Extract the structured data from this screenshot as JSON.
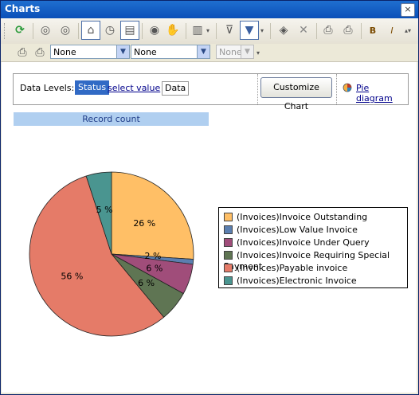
{
  "window": {
    "title": "Charts",
    "close_glyph": "×"
  },
  "toolbar2": {
    "select1": "None",
    "select2": "None",
    "select3": "None"
  },
  "level_bar": {
    "label": "Data Levels:",
    "status": "Status",
    "select_value": "select value",
    "data": "Data",
    "customize": "Customize Chart",
    "pie_link": "Pie diagram"
  },
  "record_header": "Record count",
  "chart_data": {
    "type": "pie",
    "series": [
      {
        "name": "(Invoices)Invoice Outstanding",
        "value": 26,
        "label": "26 %",
        "color": "#ffbf66"
      },
      {
        "name": "(Invoices)Low Value Invoice",
        "value": 1,
        "label": "",
        "color": "#5b7fb0"
      },
      {
        "name": "(Invoices)Invoice Under Query",
        "value": 6,
        "label": "6 %",
        "color": "#a04d7a"
      },
      {
        "name": "(Invoices)Invoice Requiring Special Payment",
        "value": 6,
        "label": "6 %",
        "color": "#5f7553"
      },
      {
        "name": "(Invoices)Payable invoice",
        "value": 56,
        "label": "56 %",
        "color": "#e57b68"
      },
      {
        "name": "(Invoices)Electronic Invoice",
        "value": 5,
        "label": "5 %",
        "color": "#4a9590"
      }
    ],
    "stray_label": "2 %"
  }
}
